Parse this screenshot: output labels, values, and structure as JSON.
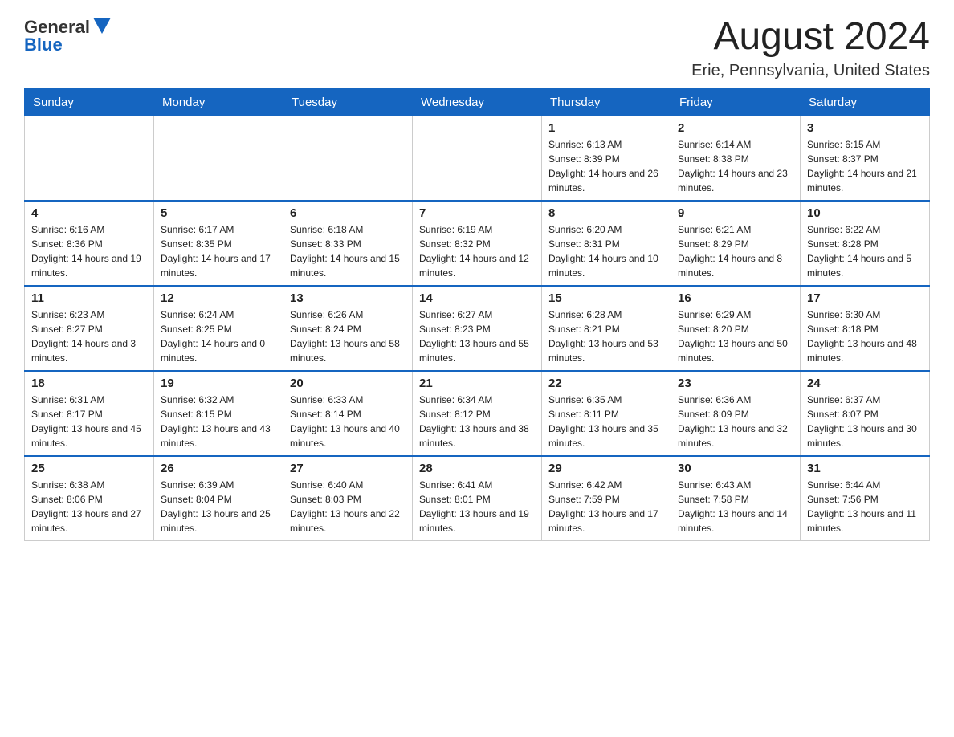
{
  "header": {
    "logo_general": "General",
    "logo_blue": "Blue",
    "month": "August 2024",
    "location": "Erie, Pennsylvania, United States"
  },
  "days_of_week": [
    "Sunday",
    "Monday",
    "Tuesday",
    "Wednesday",
    "Thursday",
    "Friday",
    "Saturday"
  ],
  "weeks": [
    [
      {
        "day": "",
        "info": ""
      },
      {
        "day": "",
        "info": ""
      },
      {
        "day": "",
        "info": ""
      },
      {
        "day": "",
        "info": ""
      },
      {
        "day": "1",
        "info": "Sunrise: 6:13 AM\nSunset: 8:39 PM\nDaylight: 14 hours and 26 minutes."
      },
      {
        "day": "2",
        "info": "Sunrise: 6:14 AM\nSunset: 8:38 PM\nDaylight: 14 hours and 23 minutes."
      },
      {
        "day": "3",
        "info": "Sunrise: 6:15 AM\nSunset: 8:37 PM\nDaylight: 14 hours and 21 minutes."
      }
    ],
    [
      {
        "day": "4",
        "info": "Sunrise: 6:16 AM\nSunset: 8:36 PM\nDaylight: 14 hours and 19 minutes."
      },
      {
        "day": "5",
        "info": "Sunrise: 6:17 AM\nSunset: 8:35 PM\nDaylight: 14 hours and 17 minutes."
      },
      {
        "day": "6",
        "info": "Sunrise: 6:18 AM\nSunset: 8:33 PM\nDaylight: 14 hours and 15 minutes."
      },
      {
        "day": "7",
        "info": "Sunrise: 6:19 AM\nSunset: 8:32 PM\nDaylight: 14 hours and 12 minutes."
      },
      {
        "day": "8",
        "info": "Sunrise: 6:20 AM\nSunset: 8:31 PM\nDaylight: 14 hours and 10 minutes."
      },
      {
        "day": "9",
        "info": "Sunrise: 6:21 AM\nSunset: 8:29 PM\nDaylight: 14 hours and 8 minutes."
      },
      {
        "day": "10",
        "info": "Sunrise: 6:22 AM\nSunset: 8:28 PM\nDaylight: 14 hours and 5 minutes."
      }
    ],
    [
      {
        "day": "11",
        "info": "Sunrise: 6:23 AM\nSunset: 8:27 PM\nDaylight: 14 hours and 3 minutes."
      },
      {
        "day": "12",
        "info": "Sunrise: 6:24 AM\nSunset: 8:25 PM\nDaylight: 14 hours and 0 minutes."
      },
      {
        "day": "13",
        "info": "Sunrise: 6:26 AM\nSunset: 8:24 PM\nDaylight: 13 hours and 58 minutes."
      },
      {
        "day": "14",
        "info": "Sunrise: 6:27 AM\nSunset: 8:23 PM\nDaylight: 13 hours and 55 minutes."
      },
      {
        "day": "15",
        "info": "Sunrise: 6:28 AM\nSunset: 8:21 PM\nDaylight: 13 hours and 53 minutes."
      },
      {
        "day": "16",
        "info": "Sunrise: 6:29 AM\nSunset: 8:20 PM\nDaylight: 13 hours and 50 minutes."
      },
      {
        "day": "17",
        "info": "Sunrise: 6:30 AM\nSunset: 8:18 PM\nDaylight: 13 hours and 48 minutes."
      }
    ],
    [
      {
        "day": "18",
        "info": "Sunrise: 6:31 AM\nSunset: 8:17 PM\nDaylight: 13 hours and 45 minutes."
      },
      {
        "day": "19",
        "info": "Sunrise: 6:32 AM\nSunset: 8:15 PM\nDaylight: 13 hours and 43 minutes."
      },
      {
        "day": "20",
        "info": "Sunrise: 6:33 AM\nSunset: 8:14 PM\nDaylight: 13 hours and 40 minutes."
      },
      {
        "day": "21",
        "info": "Sunrise: 6:34 AM\nSunset: 8:12 PM\nDaylight: 13 hours and 38 minutes."
      },
      {
        "day": "22",
        "info": "Sunrise: 6:35 AM\nSunset: 8:11 PM\nDaylight: 13 hours and 35 minutes."
      },
      {
        "day": "23",
        "info": "Sunrise: 6:36 AM\nSunset: 8:09 PM\nDaylight: 13 hours and 32 minutes."
      },
      {
        "day": "24",
        "info": "Sunrise: 6:37 AM\nSunset: 8:07 PM\nDaylight: 13 hours and 30 minutes."
      }
    ],
    [
      {
        "day": "25",
        "info": "Sunrise: 6:38 AM\nSunset: 8:06 PM\nDaylight: 13 hours and 27 minutes."
      },
      {
        "day": "26",
        "info": "Sunrise: 6:39 AM\nSunset: 8:04 PM\nDaylight: 13 hours and 25 minutes."
      },
      {
        "day": "27",
        "info": "Sunrise: 6:40 AM\nSunset: 8:03 PM\nDaylight: 13 hours and 22 minutes."
      },
      {
        "day": "28",
        "info": "Sunrise: 6:41 AM\nSunset: 8:01 PM\nDaylight: 13 hours and 19 minutes."
      },
      {
        "day": "29",
        "info": "Sunrise: 6:42 AM\nSunset: 7:59 PM\nDaylight: 13 hours and 17 minutes."
      },
      {
        "day": "30",
        "info": "Sunrise: 6:43 AM\nSunset: 7:58 PM\nDaylight: 13 hours and 14 minutes."
      },
      {
        "day": "31",
        "info": "Sunrise: 6:44 AM\nSunset: 7:56 PM\nDaylight: 13 hours and 11 minutes."
      }
    ]
  ]
}
